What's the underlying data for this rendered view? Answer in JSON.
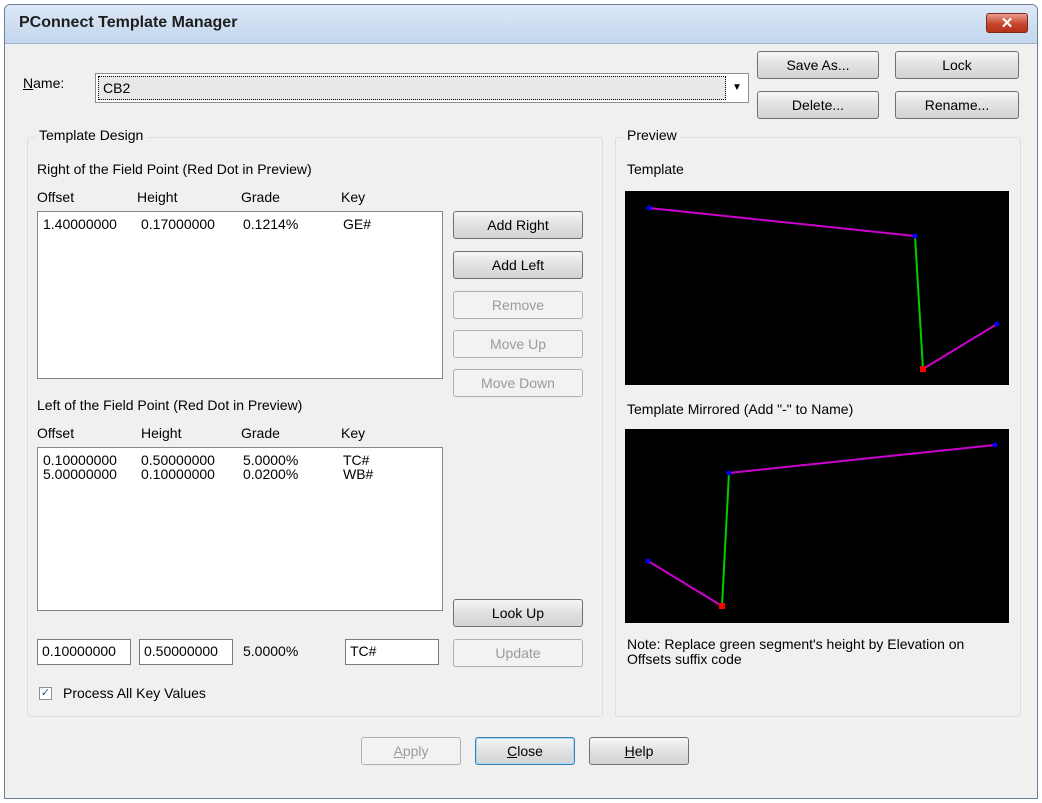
{
  "window": {
    "title": "PConnect Template Manager",
    "close_glyph": "✕"
  },
  "name": {
    "label_underlined": "N",
    "label_rest": "ame:",
    "value": "CB2"
  },
  "top_buttons": {
    "save_as": "Save As...",
    "lock": "Lock",
    "delete": "Delete...",
    "rename": "Rename..."
  },
  "template_design": {
    "group_label": "Template Design",
    "right_label": "Right of the Field Point (Red Dot in Preview)",
    "left_label": "Left of the Field Point (Red Dot in Preview)",
    "columns": [
      "Offset",
      "Height",
      "Grade",
      "Key"
    ],
    "right_rows": [
      {
        "offset": "1.40000000",
        "height": "0.17000000",
        "grade": "0.1214%",
        "key": "GE#"
      }
    ],
    "left_rows": [
      {
        "offset": "0.10000000",
        "height": "0.50000000",
        "grade": "5.0000%",
        "key": "TC#"
      },
      {
        "offset": "5.00000000",
        "height": "0.10000000",
        "grade": "0.0200%",
        "key": "WB#"
      }
    ],
    "edit": {
      "offset": "0.10000000",
      "height": "0.50000000",
      "grade": "5.0000%",
      "key": "TC#"
    },
    "process_all_label": "Process All Key Values",
    "process_all_checked": true
  },
  "side_buttons": {
    "add_right": "Add Right",
    "add_left": "Add Left",
    "remove": "Remove",
    "move_up": "Move Up",
    "move_down": "Move Down",
    "look_up": "Look Up",
    "update": "Update"
  },
  "preview": {
    "group_label": "Preview",
    "template_label": "Template",
    "mirrored_label": "Template Mirrored (Add \"-\" to Name)",
    "note": "Note: Replace green segment's height by Elevation on Offsets suffix code",
    "colors": {
      "background": "#000000",
      "segment": "#cc00cc",
      "green_segment": "#00cc00",
      "point": "#0000ff",
      "field_point": "#ff0000"
    }
  },
  "bottom_buttons": {
    "apply_ul": "A",
    "apply_rest": "pply",
    "close_ul": "C",
    "close_rest": "lose",
    "help_ul": "H",
    "help_rest": "elp"
  }
}
